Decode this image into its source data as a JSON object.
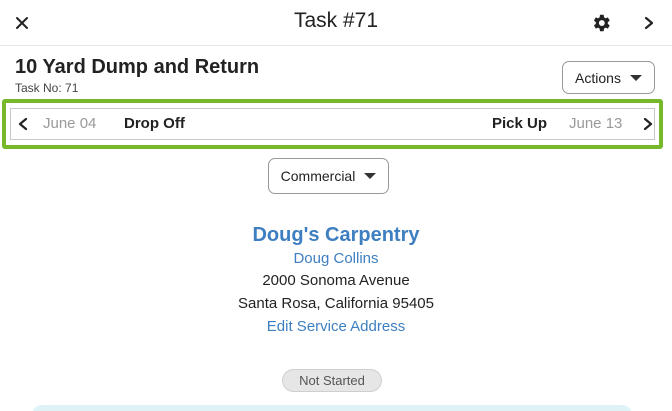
{
  "header": {
    "title": "Task #71",
    "icons": {
      "close": "close-icon",
      "settings": "gear-icon",
      "next": "chevron-right-icon"
    }
  },
  "task": {
    "name": "10 Yard Dump and Return",
    "number_label": "Task No: 71"
  },
  "actions": {
    "label": "Actions"
  },
  "date_nav": {
    "prev_date": "June 04",
    "drop_off_label": "Drop Off",
    "pick_up_label": "Pick Up",
    "next_date": "June 13",
    "highlight_color": "#76b82a"
  },
  "customer_type": {
    "selected": "Commercial"
  },
  "customer": {
    "company": "Doug's Carpentry",
    "contact": "Doug Collins",
    "address_line1": "2000 Sonoma Avenue",
    "address_line2": "Santa Rosa, California 95405",
    "edit_link": "Edit Service Address",
    "link_color": "#3e7fc1"
  },
  "status": {
    "label": "Not Started"
  }
}
